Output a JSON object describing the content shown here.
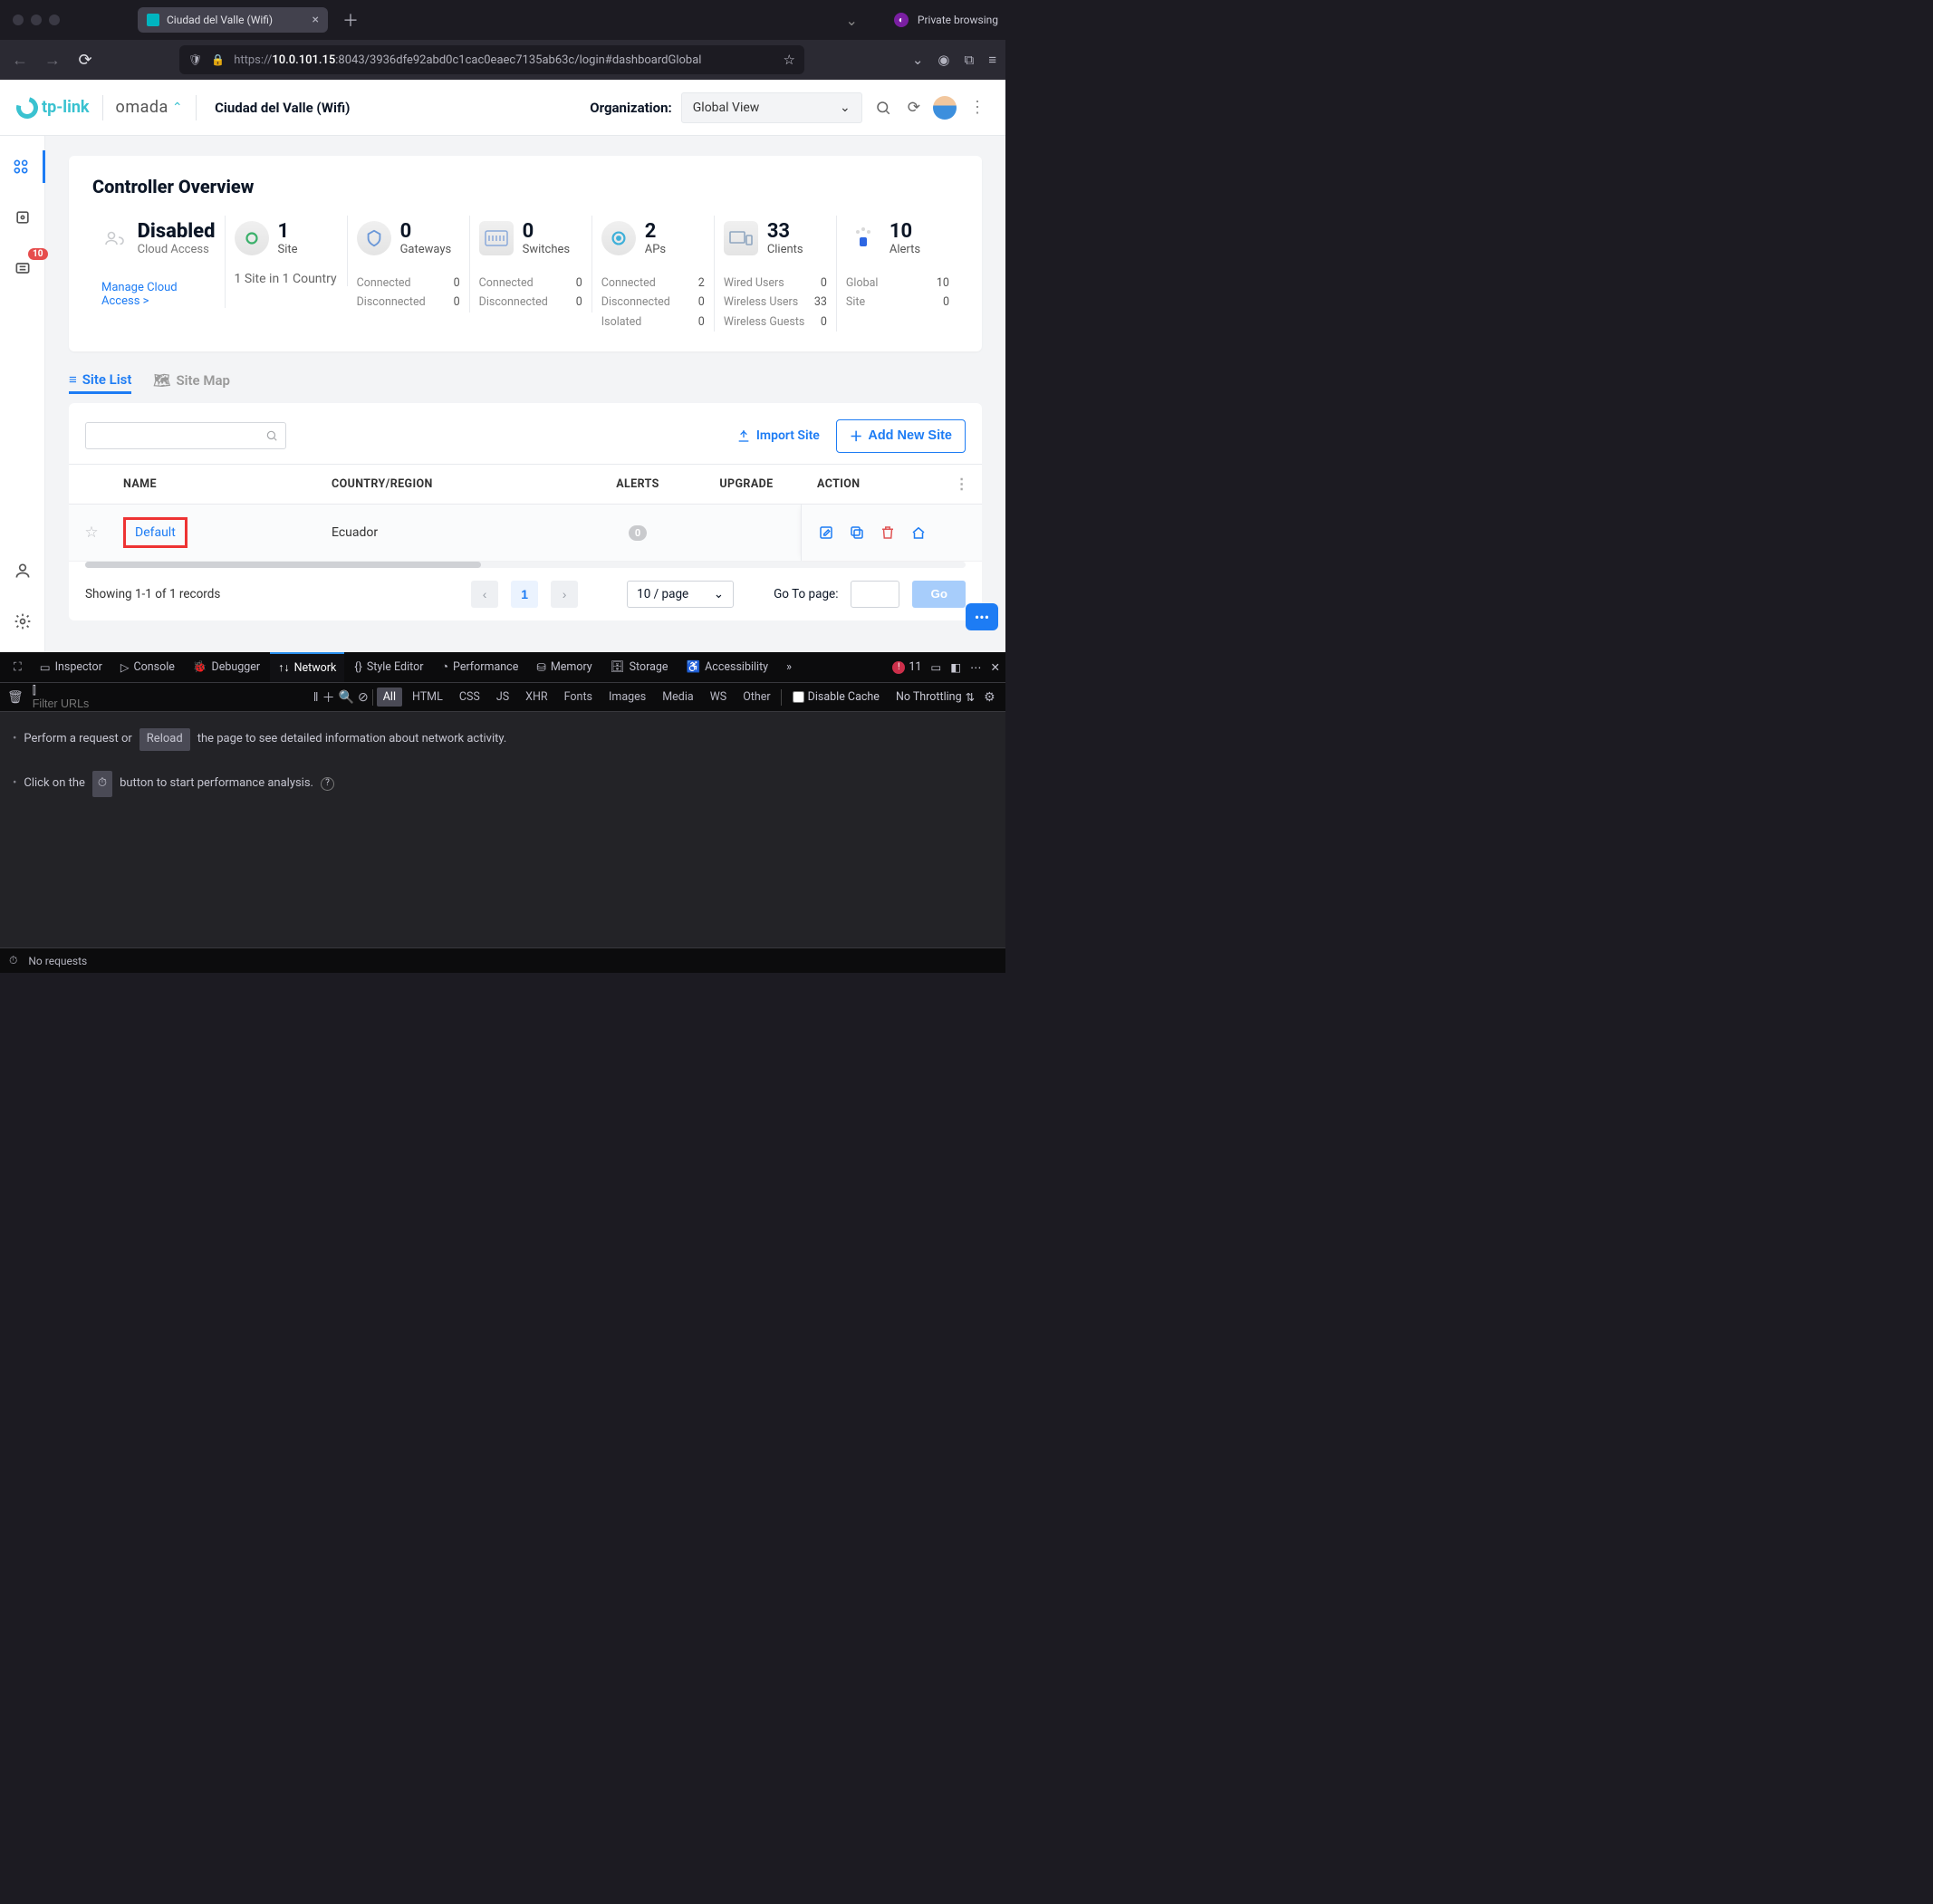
{
  "browser": {
    "tab_title": "Ciudad del Valle (Wifi)",
    "private_label": "Private browsing",
    "url_proto": "https://",
    "url_host": "10.0.101.15",
    "url_rest": ":8043/3936dfe92abd0c1cac0eaec7135ab63c/login#dashboardGlobal"
  },
  "header": {
    "tp_brand": "tp-link",
    "omada_brand": "omada",
    "site_name": "Ciudad del Valle (Wifi)",
    "org_label": "Organization:",
    "org_value": "Global View"
  },
  "sidebar": {
    "alert_badge": "10"
  },
  "overview": {
    "title": "Controller Overview",
    "cloud": {
      "status": "Disabled",
      "label": "Cloud Access",
      "manage": "Manage Cloud Access >"
    },
    "site": {
      "value": "1",
      "label": "Site",
      "sub": "1 Site in 1 Country"
    },
    "gateways": {
      "value": "0",
      "label": "Gateways",
      "rows": [
        [
          "Connected",
          "0"
        ],
        [
          "Disconnected",
          "0"
        ]
      ]
    },
    "switches": {
      "value": "0",
      "label": "Switches",
      "rows": [
        [
          "Connected",
          "0"
        ],
        [
          "Disconnected",
          "0"
        ]
      ]
    },
    "aps": {
      "value": "2",
      "label": "APs",
      "rows": [
        [
          "Connected",
          "2"
        ],
        [
          "Disconnected",
          "0"
        ],
        [
          "Isolated",
          "0"
        ]
      ]
    },
    "clients": {
      "value": "33",
      "label": "Clients",
      "rows": [
        [
          "Wired Users",
          "0"
        ],
        [
          "Wireless Users",
          "33"
        ],
        [
          "Wireless Guests",
          "0"
        ]
      ]
    },
    "alerts": {
      "value": "10",
      "label": "Alerts",
      "rows": [
        [
          "Global",
          "10"
        ],
        [
          "Site",
          "0"
        ]
      ]
    }
  },
  "tabs": {
    "list": "Site List",
    "map": "Site Map"
  },
  "sitelist": {
    "import": "Import Site",
    "add": "Add New Site",
    "head": {
      "name": "NAME",
      "country": "COUNTRY/REGION",
      "alerts": "ALERTS",
      "upgrade": "UPGRADE",
      "action": "ACTION"
    },
    "row": {
      "name": "Default",
      "country": "Ecuador",
      "alerts": "0"
    },
    "pager": {
      "info": "Showing 1-1 of 1 records",
      "page": "1",
      "size": "10 / page",
      "goto_label": "Go To page:",
      "go": "Go"
    }
  },
  "devtools": {
    "tabs": [
      "Inspector",
      "Console",
      "Debugger",
      "Network",
      "Style Editor",
      "Performance",
      "Memory",
      "Storage",
      "Accessibility"
    ],
    "err_count": "11",
    "filter_placeholder": "Filter URLs",
    "chips": [
      "All",
      "HTML",
      "CSS",
      "JS",
      "XHR",
      "Fonts",
      "Images",
      "Media",
      "WS",
      "Other"
    ],
    "disable_cache": "Disable Cache",
    "throttle": "No Throttling",
    "line1_a": "Perform a request or",
    "line1_btn": "Reload",
    "line1_b": "the page to see detailed information about network activity.",
    "line2_a": "Click on the",
    "line2_b": "button to start performance analysis.",
    "status": "No requests"
  }
}
